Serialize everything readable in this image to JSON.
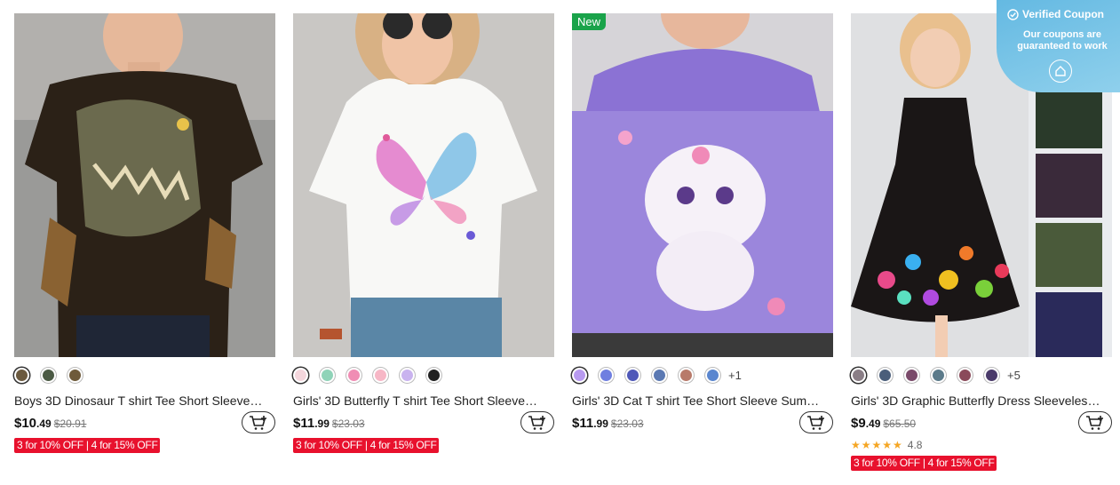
{
  "products": [
    {
      "title": "Boys 3D Dinosaur T shirt Tee Short Sleeve…",
      "price_main": "$10",
      "price_cents": ".49",
      "old_price": "$20.91",
      "promo": "3 for 10% OFF | 4 for 15% OFF",
      "swatch_colors": [
        "#6b5a3f",
        "#4b5a44",
        "#6e5a3a"
      ],
      "more_swatches": ""
    },
    {
      "title": "Girls' 3D Butterfly T shirt Tee Short Sleeve…",
      "price_main": "$11",
      "price_cents": ".99",
      "old_price": "$23.03",
      "promo": "3 for 10% OFF | 4 for 15% OFF",
      "swatch_colors": [
        "#f4d6dc",
        "#8fd3b8",
        "#f08db4",
        "#f7b7c6",
        "#c9b3ef",
        "#222222"
      ]
    },
    {
      "title": "Girls' 3D Cat T shirt Tee Short Sleeve Summ…",
      "price_main": "$11",
      "price_cents": ".99",
      "old_price": "$23.03",
      "badge": "New",
      "swatch_colors": [
        "#b89af0",
        "#6f7fe0",
        "#4f58b8",
        "#5b79b3",
        "#b87a6a",
        "#5a86cf"
      ],
      "more_swatches": "+1"
    },
    {
      "title": "Girls' 3D Graphic Butterfly Dress Sleeveless…",
      "price_main": "$9",
      "price_cents": ".49",
      "old_price": "$65.50",
      "rating_stars": "★★★★★",
      "rating_value": "4.8",
      "promo": "3 for 10% OFF | 4 for 15% OFF",
      "swatch_colors": [
        "#8a7e86",
        "#4a5e7a",
        "#7a4a6a",
        "#5b7a8a",
        "#8a4a5a",
        "#4a3a6a"
      ],
      "more_swatches": "+5"
    }
  ],
  "coupon": {
    "title": "Verified Coupon",
    "subtitle": "Our coupons are guaranteed to work"
  },
  "colors": {
    "promo_red": "#e8112d",
    "new_green": "#1aa34a",
    "coupon_blue": "#64b9e2",
    "star_gold": "#f5a623"
  }
}
